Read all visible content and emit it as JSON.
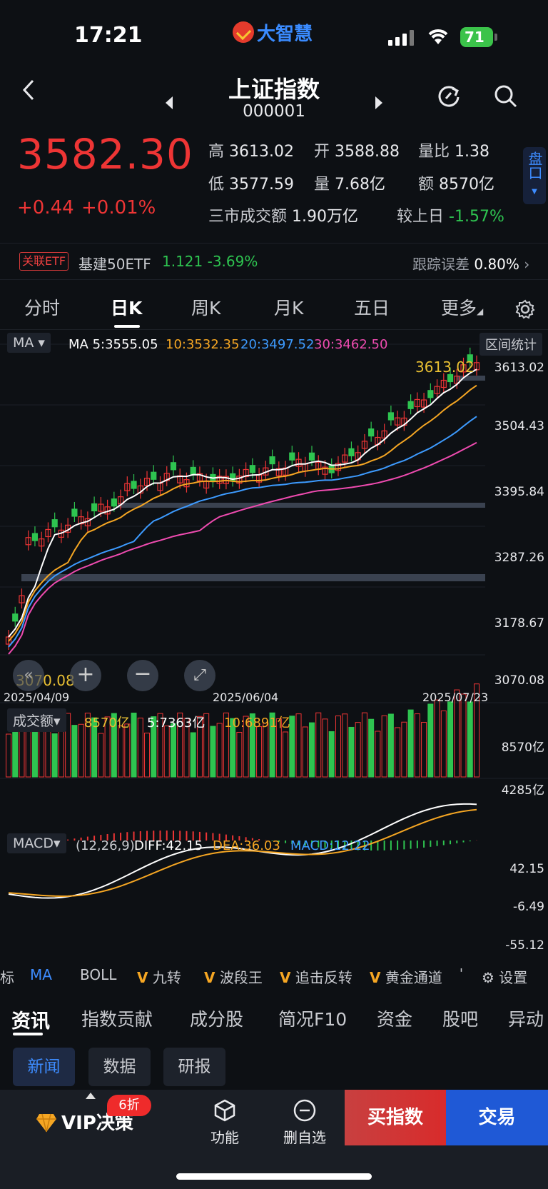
{
  "status": {
    "time": "17:21",
    "battery": "71"
  },
  "app": {
    "logo_text": "大智慧"
  },
  "header": {
    "title": "上证指数",
    "code": "000001"
  },
  "quote": {
    "price": "3582.30",
    "change": "+0.44",
    "change_pct": "+0.01%",
    "high_label": "高",
    "high": "3613.02",
    "open_label": "开",
    "open": "3588.88",
    "ratio_label": "量比",
    "ratio": "1.38",
    "low_label": "低",
    "low": "3577.59",
    "vol_label": "量",
    "vol": "7.68亿",
    "amount_label": "额",
    "amount": "8570亿",
    "market_label": "三市成交额",
    "market": "1.90万亿",
    "vs_label": "较上日",
    "vs": "-1.57%"
  },
  "pankou": "盘口",
  "etf": {
    "tag": "关联ETF",
    "name": "基建50ETF",
    "price_change": "1.121 -3.69%",
    "track_label": "跟踪误差",
    "track": "0.80%"
  },
  "tabs": [
    "分时",
    "日K",
    "周K",
    "月K",
    "五日",
    "更多"
  ],
  "kline": {
    "ma_chip": "MA",
    "ma5": "MA 5:3555.05",
    "ma10": "10:3532.35",
    "ma20": "20:3497.52",
    "ma30": "30:3462.50",
    "range_btn": "区间统计",
    "hi_mark": "3613.02",
    "lo_mark": "3070.08",
    "y_labels": [
      "3613.02",
      "3504.43",
      "3395.84",
      "3287.26",
      "3178.67",
      "3070.08"
    ],
    "dates": [
      "2025/04/09",
      "2025/06/04",
      "2025/07/23"
    ]
  },
  "volume": {
    "chip": "成交额",
    "now": "8570亿",
    "ma5": "5:7363亿",
    "ma10": "10:6891亿",
    "y_labels": [
      "8570亿",
      "4285亿"
    ]
  },
  "macd": {
    "chip": "MACD",
    "params": "(12,26,9)",
    "diff": "DIFF:42.15",
    "dea": "DEA:36.03",
    "macd": "MACD:12.22",
    "y_labels": [
      "42.15",
      "-6.49",
      "-55.12"
    ]
  },
  "indicators": [
    "标",
    "MA",
    "BOLL",
    "九转",
    "波段王",
    "追击反转",
    "黄金通道",
    "设置"
  ],
  "sections": [
    "资讯",
    "指数贡献",
    "成分股",
    "简况F10",
    "资金",
    "股吧",
    "异动"
  ],
  "pills": [
    "新闻",
    "数据",
    "研报"
  ],
  "bottom": {
    "vip": "VIP决策",
    "vip_tag": "6折",
    "func": "功能",
    "remove": "删自选",
    "buy": "买指数",
    "trade": "交易"
  },
  "colors": {
    "up": "#ee3535",
    "down": "#2ec450",
    "ma5": "#ffffff",
    "ma10": "#f5a623",
    "ma20": "#3d9bff",
    "ma30": "#ef4bb0",
    "accent": "#1f59d6"
  }
}
